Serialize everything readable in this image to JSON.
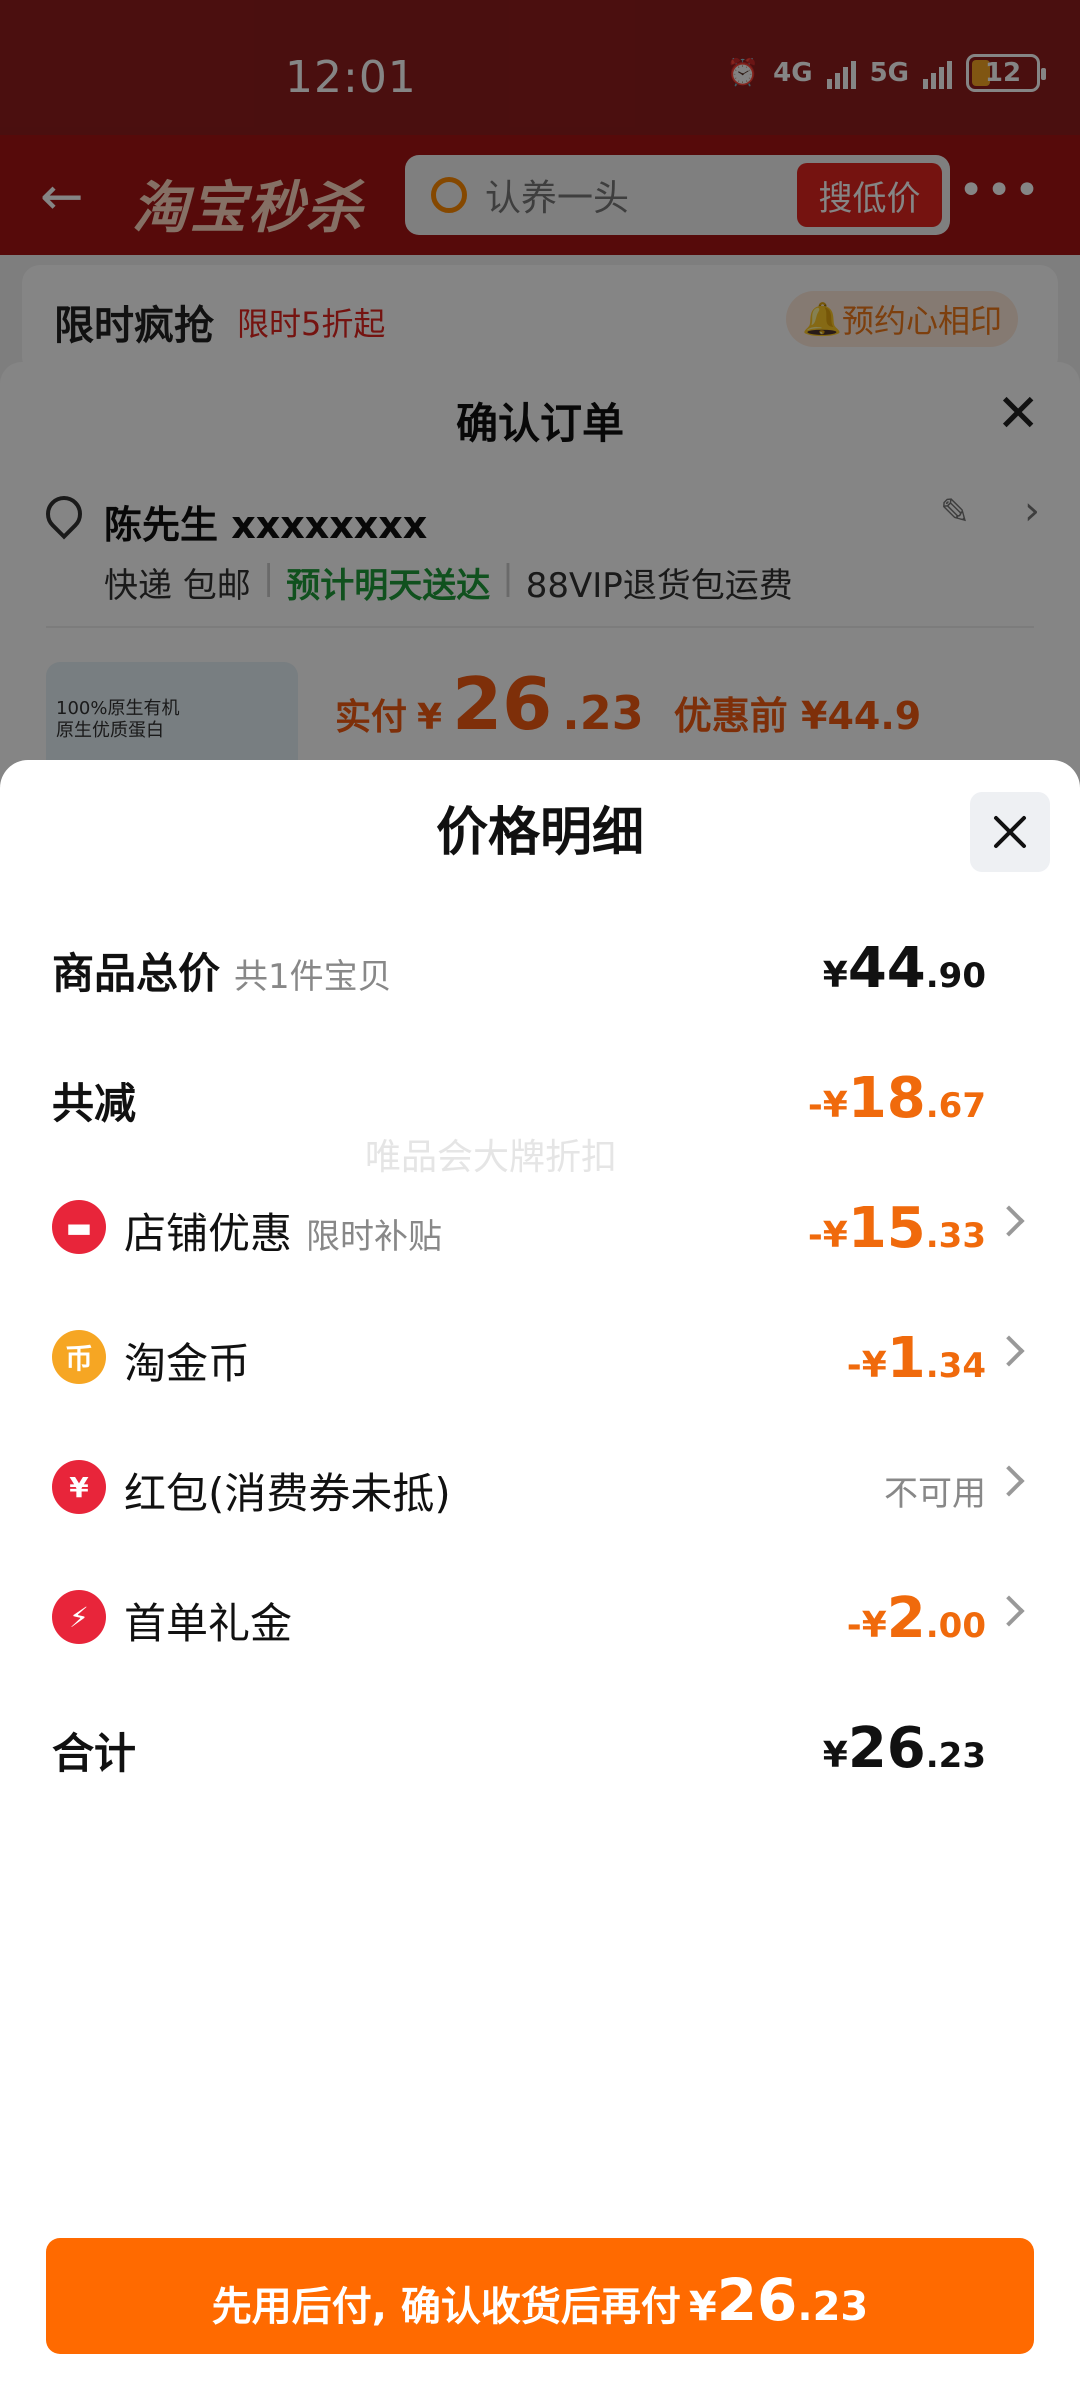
{
  "status_bar": {
    "time": "12:01",
    "net1": "4G",
    "net2": "5G",
    "battery": "12"
  },
  "top_nav": {
    "logo": "淘宝秒杀",
    "search_query": "认养一头",
    "search_button": "搜低价"
  },
  "promo": {
    "title": "限时疯抢",
    "subtitle": "限时5折起",
    "remind": "预约心相印"
  },
  "order": {
    "title": "确认订单",
    "address_name": "陈先生 xxxxxxxx",
    "shipping": "快递 包邮",
    "eta": "预计明天送达",
    "vip": "88VIP退货包运费",
    "product_thumb_text": "100%原生有机\n原生优质蛋白",
    "paid_label": "实付",
    "paid_currency": "¥",
    "paid_int": "26",
    "paid_dec": ".23",
    "pre_discount": "优惠前 ¥44.9"
  },
  "sheet": {
    "title": "价格明细",
    "watermark": "唯品会大牌折扣",
    "rows": {
      "total": {
        "label": "商品总价",
        "sub": "共1件宝贝",
        "prefix": "",
        "currency": "¥",
        "int": "44",
        "dec": ".90"
      },
      "reduce": {
        "label": "共减",
        "prefix": "-",
        "currency": "¥",
        "int": "18",
        "dec": ".67"
      },
      "store": {
        "label": "店铺优惠",
        "sub": "限时补贴",
        "prefix": "-",
        "currency": "¥",
        "int": "15",
        "dec": ".33",
        "icon_color": "#e8253a"
      },
      "coin": {
        "label": "淘金币",
        "prefix": "-",
        "currency": "¥",
        "int": "1",
        "dec": ".34",
        "icon_color": "#f6a623"
      },
      "redpacket": {
        "label": "红包(消费券未抵)",
        "value_text": "不可用",
        "icon_color": "#e8253a"
      },
      "firstorder": {
        "label": "首单礼金",
        "prefix": "-",
        "currency": "¥",
        "int": "2",
        "dec": ".00",
        "icon_color": "#e8253a"
      },
      "sum": {
        "label": "合计",
        "currency": "¥",
        "int": "26",
        "dec": ".23"
      }
    }
  },
  "cta": {
    "text": "先用后付, 确认收货后再付",
    "currency": "¥",
    "int": "26",
    "dec": ".23"
  },
  "colors": {
    "accent_orange": "#ff6a00",
    "discount_orange": "#f06a0c",
    "header_red": "#8f1d1d"
  }
}
